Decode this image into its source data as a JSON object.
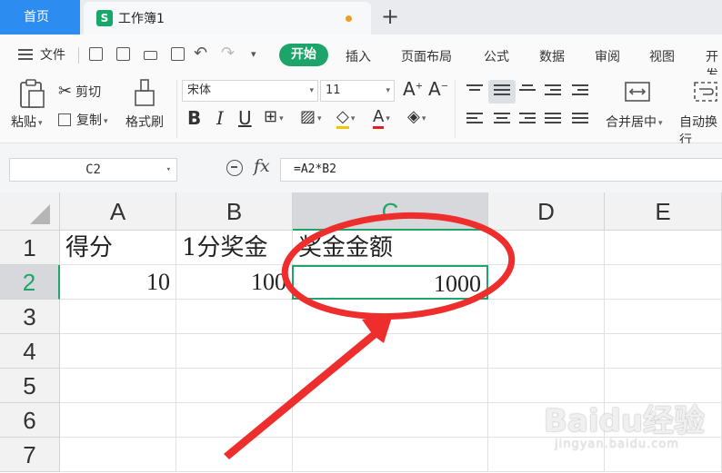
{
  "tabs": {
    "home": "首页",
    "document": "工作簿1",
    "add": "+"
  },
  "menubar": {
    "file": "文件",
    "start": "开始",
    "items": [
      "插入",
      "页面布局",
      "公式",
      "数据",
      "审阅",
      "视图",
      "开发"
    ]
  },
  "ribbon": {
    "paste": "粘贴",
    "cut": "剪切",
    "copy": "复制",
    "format_painter": "格式刷",
    "font_name": "宋体",
    "font_size": "11",
    "merge_center": "合并居中",
    "auto_wrap": "自动换行"
  },
  "formula_bar": {
    "name_box": "C2",
    "fx": "fx",
    "formula": "=A2*B2"
  },
  "sheet": {
    "columns": [
      "A",
      "B",
      "C",
      "D",
      "E"
    ],
    "rows": [
      "1",
      "2",
      "3",
      "4",
      "5",
      "6",
      "7"
    ],
    "cells": {
      "A1": "得分",
      "B1": "1分奖金",
      "C1": "奖金金额",
      "A2": "10",
      "B2": "100",
      "C2": "1000"
    },
    "selected_cell": "C2"
  },
  "colors": {
    "accent": "#1ca46b",
    "annotation": "#ee2d2d",
    "home_tab": "#2d8cf0"
  },
  "watermark": {
    "text": "Baidu经验",
    "subtext": "jingyan.baidu.com"
  }
}
